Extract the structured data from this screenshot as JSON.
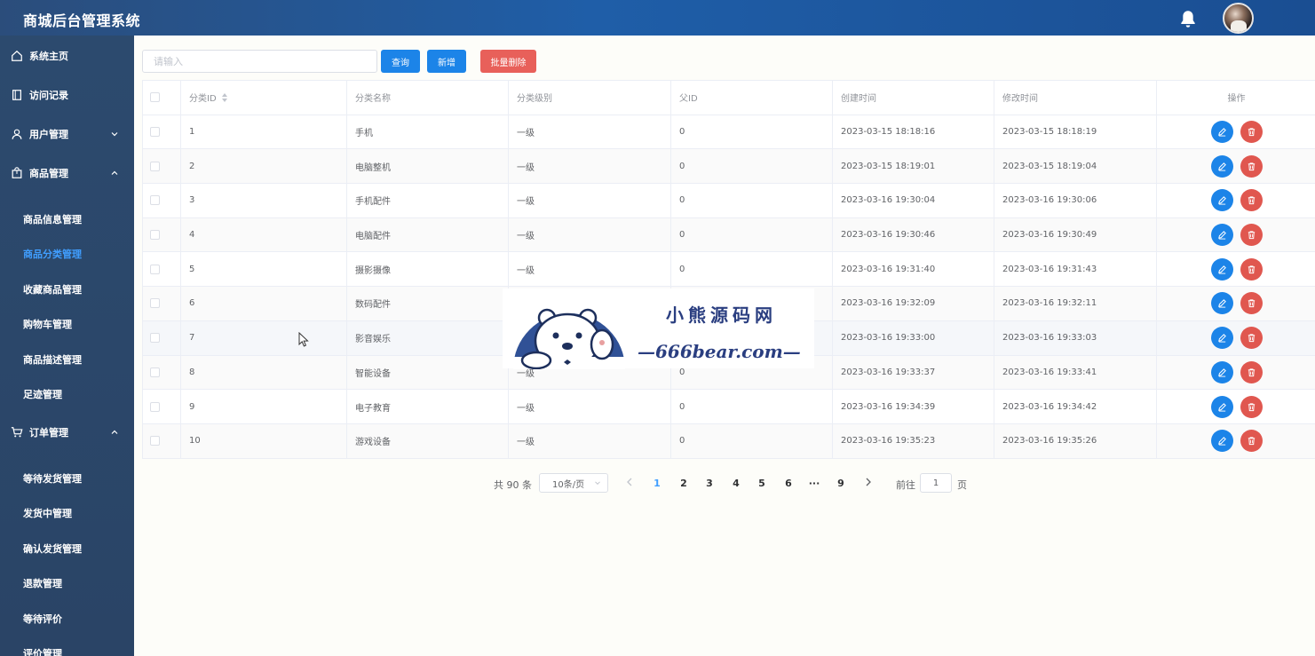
{
  "header": {
    "title": "商城后台管理系统"
  },
  "sidebar": {
    "items": [
      {
        "label": "系统主页",
        "icon": "home-icon"
      },
      {
        "label": "访问记录",
        "icon": "book-icon"
      },
      {
        "label": "用户管理",
        "icon": "user-icon",
        "expanded": false
      },
      {
        "label": "商品管理",
        "icon": "bag-icon",
        "expanded": true
      },
      {
        "label": "订单管理",
        "icon": "cart-icon",
        "expanded": true
      }
    ],
    "goods_sub": [
      "商品信息管理",
      "商品分类管理",
      "收藏商品管理",
      "购物车管理",
      "商品描述管理",
      "足迹管理"
    ],
    "order_sub": [
      "等待发货管理",
      "发货中管理",
      "确认发货管理",
      "退款管理",
      "等待评价",
      "评价管理"
    ],
    "active_sub": "商品分类管理"
  },
  "toolbar": {
    "search_placeholder": "请输入",
    "query_label": "查询",
    "add_label": "新增",
    "batch_delete_label": "批量删除"
  },
  "table": {
    "columns": [
      "分类ID",
      "分类名称",
      "分类级别",
      "父ID",
      "创建时间",
      "修改时间",
      "操作"
    ],
    "rows": [
      {
        "id": "1",
        "name": "手机",
        "level": "一级",
        "parent": "0",
        "created": "2023-03-15 18:18:16",
        "modified": "2023-03-15 18:18:19"
      },
      {
        "id": "2",
        "name": "电脑整机",
        "level": "一级",
        "parent": "0",
        "created": "2023-03-15 18:19:01",
        "modified": "2023-03-15 18:19:04"
      },
      {
        "id": "3",
        "name": "手机配件",
        "level": "一级",
        "parent": "0",
        "created": "2023-03-16 19:30:04",
        "modified": "2023-03-16 19:30:06"
      },
      {
        "id": "4",
        "name": "电脑配件",
        "level": "一级",
        "parent": "0",
        "created": "2023-03-16 19:30:46",
        "modified": "2023-03-16 19:30:49"
      },
      {
        "id": "5",
        "name": "摄影摄像",
        "level": "一级",
        "parent": "0",
        "created": "2023-03-16 19:31:40",
        "modified": "2023-03-16 19:31:43"
      },
      {
        "id": "6",
        "name": "数码配件",
        "level": "",
        "parent": "",
        "created": "2023-03-16 19:32:09",
        "modified": "2023-03-16 19:32:11"
      },
      {
        "id": "7",
        "name": "影音娱乐",
        "level": "",
        "parent": "",
        "created": "2023-03-16 19:33:00",
        "modified": "2023-03-16 19:33:03"
      },
      {
        "id": "8",
        "name": "智能设备",
        "level": "一级",
        "parent": "0",
        "created": "2023-03-16 19:33:37",
        "modified": "2023-03-16 19:33:41"
      },
      {
        "id": "9",
        "name": "电子教育",
        "level": "一级",
        "parent": "0",
        "created": "2023-03-16 19:34:39",
        "modified": "2023-03-16 19:34:42"
      },
      {
        "id": "10",
        "name": "游戏设备",
        "level": "一级",
        "parent": "0",
        "created": "2023-03-16 19:35:23",
        "modified": "2023-03-16 19:35:26"
      }
    ]
  },
  "pagination": {
    "total": "共 90 条",
    "page_size": "10条/页",
    "pages": [
      "1",
      "2",
      "3",
      "4",
      "5",
      "6",
      "···",
      "9"
    ],
    "current": "1",
    "goto_label": "前往",
    "goto_value": "1",
    "goto_unit": "页"
  },
  "watermark": {
    "title": "小熊源码网",
    "site": "—666bear.com—"
  },
  "colors": {
    "primary": "#1c84e8",
    "danger": "#e0574f",
    "sidebar": "#2c4a6e",
    "header": "#1f5ea8",
    "active": "#409eff"
  }
}
